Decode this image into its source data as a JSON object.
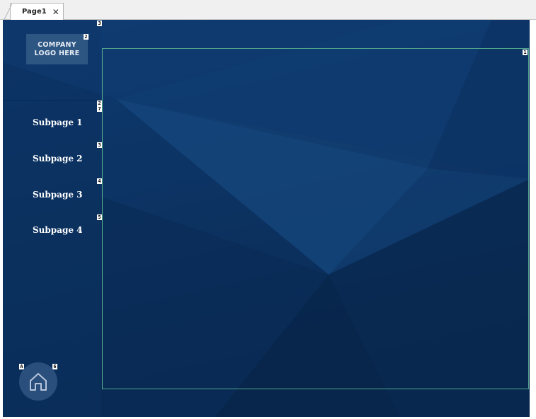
{
  "tabs": [
    {
      "label": "Page1",
      "close_glyph": "✕"
    }
  ],
  "logo": {
    "line1": "COMPANY",
    "line2": "LOGO HERE"
  },
  "nav": {
    "items": [
      {
        "label": "Subpage 1"
      },
      {
        "label": "Subpage 2"
      },
      {
        "label": "Subpage 3"
      },
      {
        "label": "Subpage 4"
      }
    ]
  },
  "markers": {
    "logo": "2",
    "sidebar_top": "3",
    "content": "1",
    "nav_top_a": "2",
    "nav_top_b": "7",
    "nav_2": "3",
    "nav_3": "4",
    "nav_4": "5",
    "home_a": "A",
    "home_b": "6"
  },
  "home_button": {
    "icon": "home-icon"
  },
  "colors": {
    "background": "#0c3566",
    "frame": "#4fa58a",
    "logo_box": "#2e5683",
    "home_button": "#2a4f7d"
  }
}
